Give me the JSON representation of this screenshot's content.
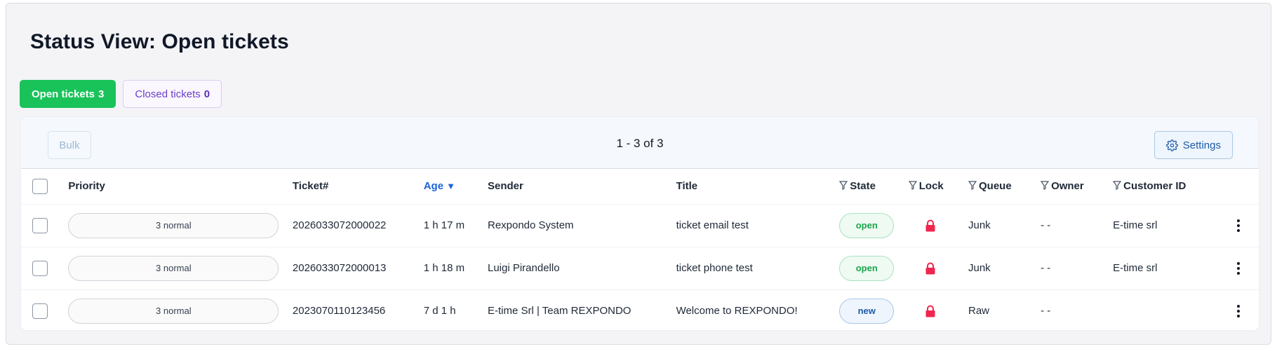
{
  "page": {
    "title": "Status View: Open tickets"
  },
  "tabs": [
    {
      "label": "Open tickets",
      "count": "3"
    },
    {
      "label": "Closed tickets",
      "count": "0"
    }
  ],
  "toolbar": {
    "bulk_label": "Bulk",
    "pager": "1 - 3 of 3",
    "settings_label": "Settings"
  },
  "table": {
    "headers": {
      "priority": "Priority",
      "ticket": "Ticket#",
      "age": "Age",
      "age_sort_icon": "▼",
      "sender": "Sender",
      "title": "Title",
      "state": "State",
      "lock": "Lock",
      "queue": "Queue",
      "owner": "Owner",
      "customer": "Customer ID"
    },
    "rows": [
      {
        "priority": "3 normal",
        "ticket": "2026033072000022",
        "age": "1 h 17 m",
        "sender": "Rexpondo System",
        "title": "ticket email test",
        "state": "open",
        "queue": "Junk",
        "owner": "- -",
        "customer": "E-time srl"
      },
      {
        "priority": "3 normal",
        "ticket": "2026033072000013",
        "age": "1 h 18 m",
        "sender": "Luigi Pirandello",
        "title": "ticket phone test",
        "state": "open",
        "queue": "Junk",
        "owner": "- -",
        "customer": "E-time srl"
      },
      {
        "priority": "3 normal",
        "ticket": "2023070110123456",
        "age": "7 d 1 h",
        "sender": "E-time Srl | Team REXPONDO",
        "title": "Welcome to REXPONDO!",
        "state": "new",
        "queue": "Raw",
        "owner": "- -",
        "customer": ""
      }
    ]
  },
  "colors": {
    "open_tab": "#19c35a",
    "closed_tab_text": "#6d3fc8",
    "lock": "#f0264f",
    "sort_header": "#1d63d6",
    "state_new": "#1e5aa8",
    "state_open": "#1ba54b"
  },
  "icons": {
    "settings": "gear-icon",
    "lock": "lock-icon",
    "filter": "filter-icon",
    "row_menu": "kebab-menu-icon"
  }
}
